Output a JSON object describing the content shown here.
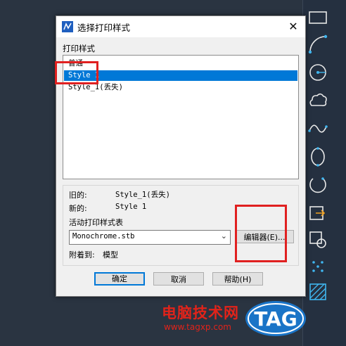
{
  "dialog": {
    "title": "选择打印样式",
    "close_glyph": "✕",
    "list_label": "打印样式",
    "styles": [
      {
        "label": "普通",
        "selected": false
      },
      {
        "label": "Style 1",
        "selected": true
      },
      {
        "label": "Style_1(丢失)",
        "selected": false
      }
    ],
    "old_label": "旧的:",
    "old_value": "Style_1(丢失)",
    "new_label": "新的:",
    "new_value": "Style 1",
    "active_table_label": "活动打印样式表",
    "active_table_value": "Monochrome.stb",
    "editor_button": "编辑器(E)...",
    "attached_label": "附着到:",
    "attached_value": "模型",
    "ok_button": "确定",
    "cancel_button": "取消",
    "help_button": "帮助(H)"
  },
  "watermark": {
    "site_name": "电脑技术网",
    "url": "www.tagxp.com",
    "logo_text": "TAG"
  },
  "colors": {
    "selection": "#0078d7",
    "annotation": "#e02020",
    "watermark": "#e2231a",
    "cad_accent": "#3fb6f0"
  }
}
